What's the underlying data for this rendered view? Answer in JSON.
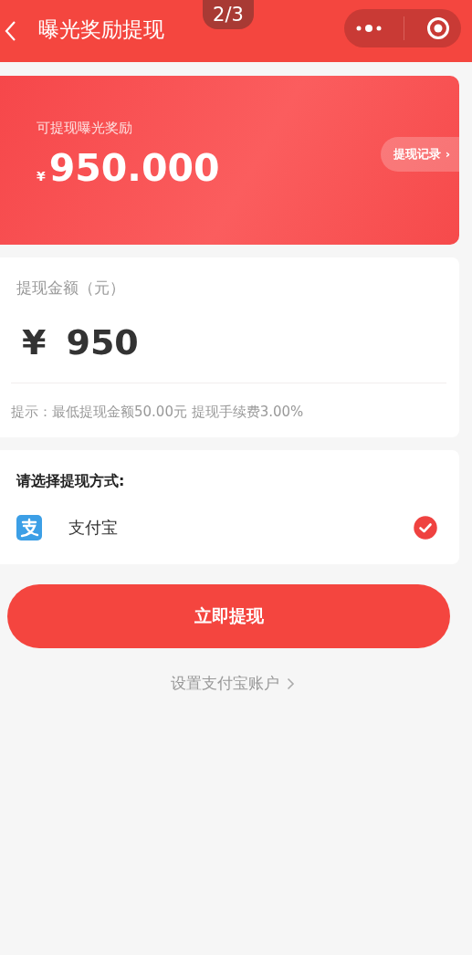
{
  "page_counter": "2/3",
  "header": {
    "title": "曝光奖励提现"
  },
  "balance_card": {
    "label": "可提现曝光奖励",
    "currency": "¥",
    "amount": "950.000",
    "records_link": "提现记录 ›"
  },
  "amount_panel": {
    "label": "提现金额（元）",
    "currency": "¥",
    "value": "950",
    "hint": "提示：最低提现金额50.00元 提现手续费3.00%"
  },
  "method_panel": {
    "title": "请选择提现方式:",
    "methods": [
      {
        "name": "支付宝",
        "selected": true
      }
    ]
  },
  "submit_button": "立即提现",
  "account_link": "设置支付宝账户"
}
